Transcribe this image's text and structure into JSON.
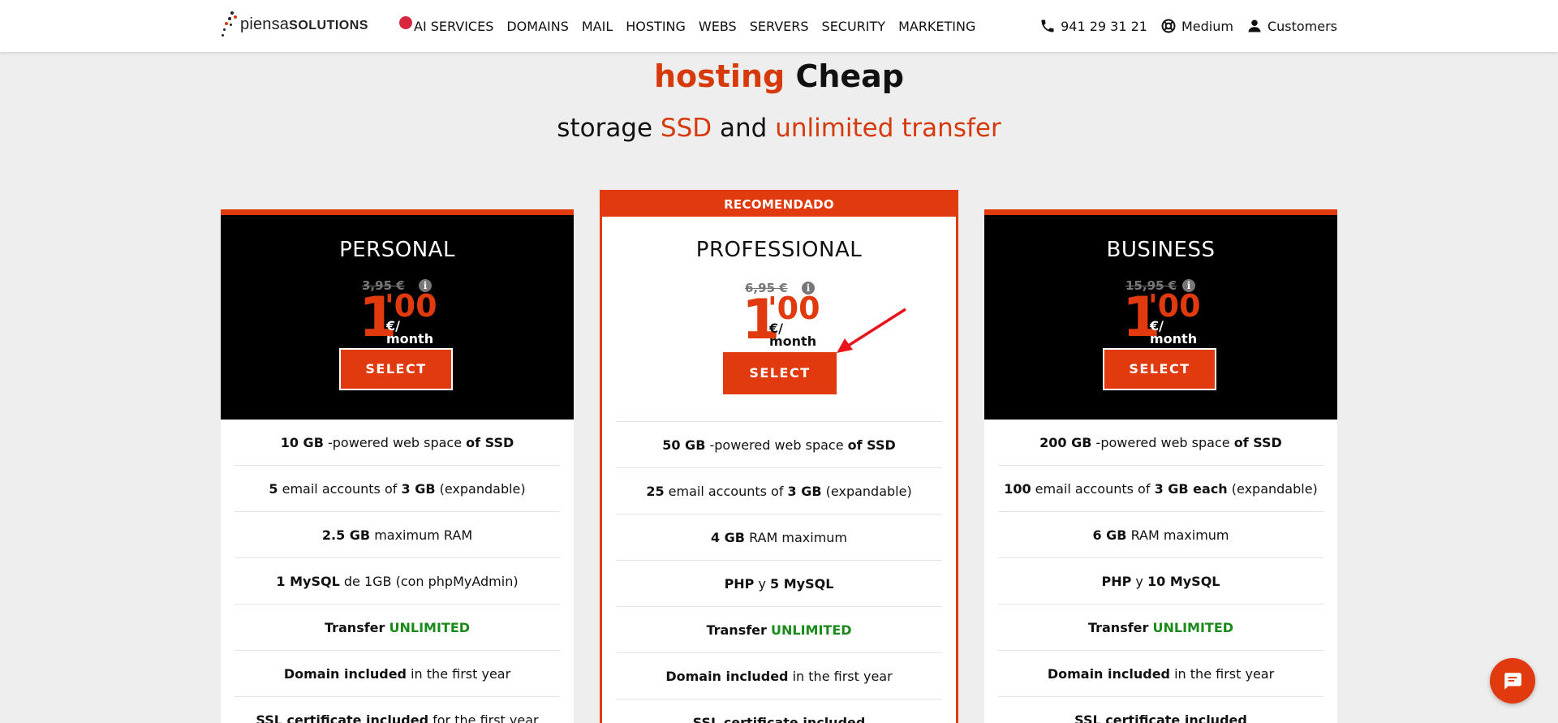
{
  "header": {
    "logo": {
      "light": "piensa",
      "bold": "SOLUTIONS"
    },
    "nav": [
      "AI SERVICES",
      "DOMAINS",
      "MAIL",
      "HOSTING",
      "WEBS",
      "SERVERS",
      "SECURITY",
      "MARKETING"
    ],
    "phone": "941 29 31 21",
    "support": "Medium",
    "account": "Customers"
  },
  "hero": {
    "title_accent": "hosting",
    "title_rest": " Cheap",
    "sub_pre": "storage ",
    "sub_ssd": "SSD",
    "sub_mid": " and ",
    "sub_unl": "unlimited transfer"
  },
  "recommended_label": "RECOMENDADO",
  "plans": [
    {
      "name": "PERSONAL",
      "old_price": "3,95 €",
      "price_int": "1",
      "price_dec": "'00",
      "unit_top": "€/",
      "unit_bottom": "month",
      "select": "SELECT",
      "features": [
        [
          "10 GB",
          " -powered web space ",
          "of SSD",
          ""
        ],
        [
          "5",
          " email accounts of ",
          "3 GB",
          " (expandable)"
        ],
        [
          "2.5 GB",
          " maximum RAM",
          "",
          ""
        ],
        [
          "1 MySQL",
          " de 1GB (con phpMyAdmin)",
          "",
          ""
        ],
        [
          "Transfer",
          " ",
          "UNLIMITED",
          ""
        ],
        [
          "Domain included",
          " in the first year",
          "",
          ""
        ],
        [
          "SSL certificate included",
          " for the first year",
          "",
          ""
        ]
      ]
    },
    {
      "name": "PROFESSIONAL",
      "old_price": "6,95 €",
      "price_int": "1",
      "price_dec": "'00",
      "unit_top": "€/",
      "unit_bottom": "month",
      "select": "SELECT",
      "features": [
        [
          "50 GB",
          " -powered web space ",
          "of SSD",
          ""
        ],
        [
          "25",
          " email accounts of ",
          "3 GB",
          " (expandable)"
        ],
        [
          "4 GB",
          " RAM maximum",
          "",
          ""
        ],
        [
          "PHP",
          " y ",
          "5 MySQL",
          ""
        ],
        [
          "Transfer",
          " ",
          "UNLIMITED",
          ""
        ],
        [
          "Domain included",
          " in the first year",
          "",
          ""
        ],
        [
          "SSL certificate included",
          "",
          "",
          ""
        ]
      ]
    },
    {
      "name": "BUSINESS",
      "old_price": "15,95 €",
      "price_int": "1",
      "price_dec": "'00",
      "unit_top": "€/",
      "unit_bottom": "month",
      "select": "SELECT",
      "features": [
        [
          "200 GB",
          " -powered web space ",
          "of SSD",
          ""
        ],
        [
          "100",
          " email accounts of ",
          "3 GB each",
          " (expandable)"
        ],
        [
          "6 GB",
          " RAM maximum",
          "",
          ""
        ],
        [
          "PHP",
          " y ",
          "10 MySQL",
          ""
        ],
        [
          "Transfer",
          " ",
          "UNLIMITED",
          ""
        ],
        [
          "Domain included",
          " in the first year",
          "",
          ""
        ],
        [
          "SSL certificate included",
          "",
          "",
          ""
        ]
      ]
    }
  ],
  "colors": {
    "accent": "#e03a0e",
    "green": "#1a8a1a"
  }
}
